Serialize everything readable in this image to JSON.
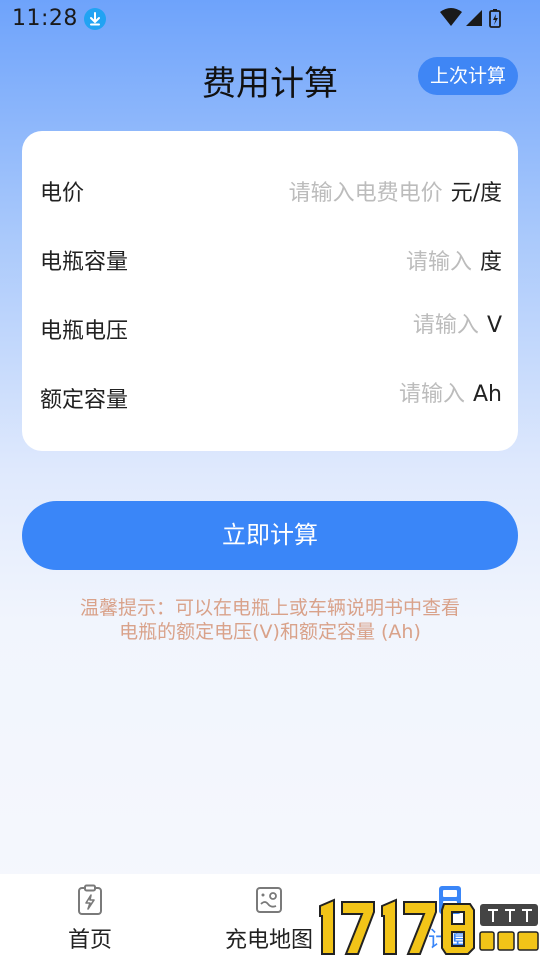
{
  "status_bar": {
    "time": "11:28"
  },
  "header": {
    "title": "费用计算",
    "last_calc_label": "上次计算"
  },
  "form": {
    "rows": [
      {
        "label": "电价",
        "placeholder": "请输入电费电价",
        "value": "",
        "unit": "元/度"
      },
      {
        "label": "电瓶容量",
        "placeholder": "请输入",
        "value": "",
        "unit": "度"
      },
      {
        "label": "电瓶电压",
        "placeholder": "请输入",
        "value": "",
        "unit": "V"
      },
      {
        "label": "额定容量",
        "placeholder": "请输入",
        "value": "",
        "unit": "Ah"
      }
    ]
  },
  "actions": {
    "calculate_label": "立即计算"
  },
  "tip": {
    "line1": "温馨提示：可以在电瓶上或车辆说明书中查看",
    "line2": "电瓶的额定电压(V)和额定容量 (Ah)"
  },
  "bottom_nav": {
    "items": [
      {
        "label": "首页",
        "icon": "clipboard-bolt-icon",
        "active": false
      },
      {
        "label": "充电地图",
        "icon": "map-icon",
        "active": false
      },
      {
        "label": "计算",
        "icon": "calculator-icon",
        "active": true
      }
    ]
  },
  "colors": {
    "accent": "#3a86f8",
    "tip": "#d9a28a",
    "placeholder": "#bcbcbc"
  }
}
